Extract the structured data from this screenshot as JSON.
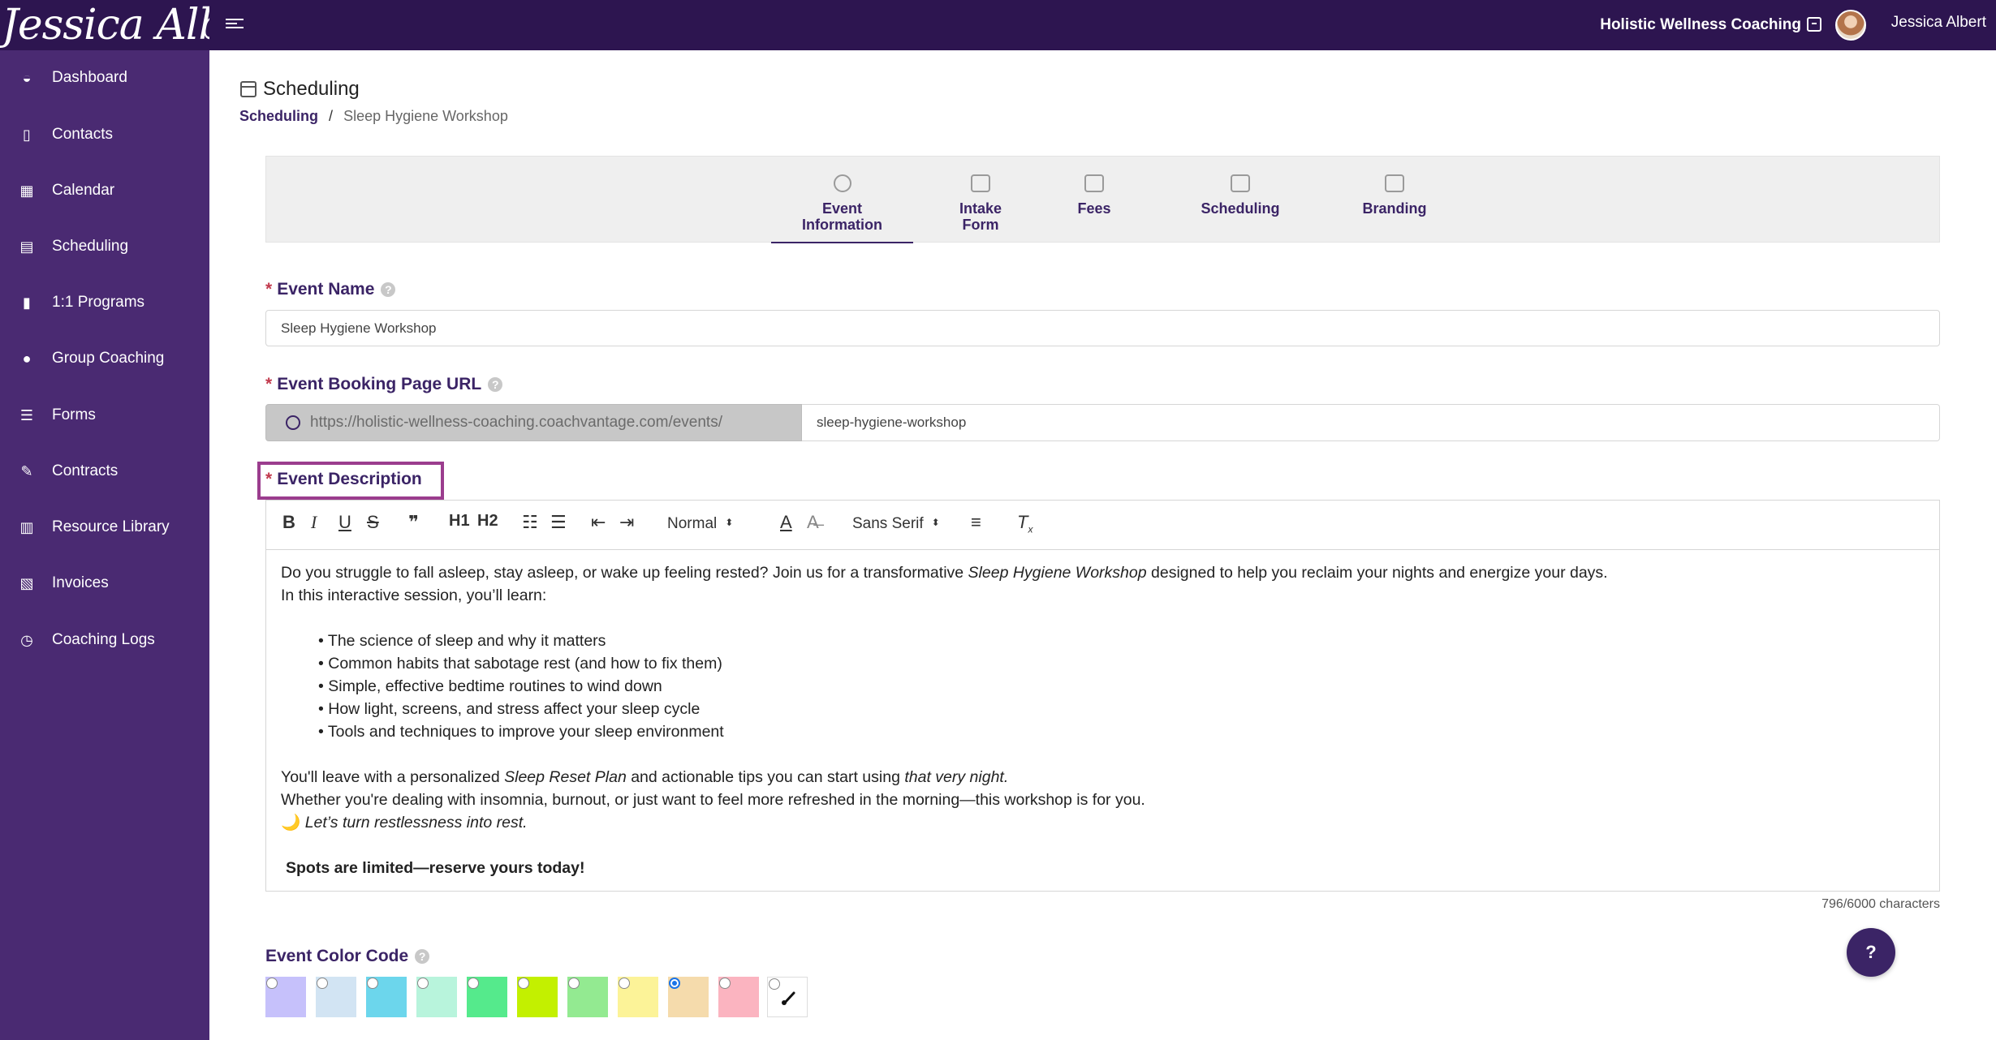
{
  "header": {
    "logo_text": "Jessica Albert",
    "org_name": "Holistic Wellness Coaching",
    "user_name": "Jessica Albert"
  },
  "sidebar": {
    "items": [
      {
        "label": "Dashboard",
        "icon": "dashboard-icon"
      },
      {
        "label": "Contacts",
        "icon": "contacts-icon"
      },
      {
        "label": "Calendar",
        "icon": "calendar-icon"
      },
      {
        "label": "Scheduling",
        "icon": "scheduling-icon"
      },
      {
        "label": "1:1 Programs",
        "icon": "book-icon"
      },
      {
        "label": "Group Coaching",
        "icon": "users-icon"
      },
      {
        "label": "Forms",
        "icon": "checklist-icon"
      },
      {
        "label": "Contracts",
        "icon": "signature-icon"
      },
      {
        "label": "Resource Library",
        "icon": "library-icon"
      },
      {
        "label": "Invoices",
        "icon": "invoice-icon"
      },
      {
        "label": "Coaching Logs",
        "icon": "clock-icon"
      }
    ]
  },
  "page": {
    "title": "Scheduling",
    "breadcrumb": {
      "root": "Scheduling",
      "separator": "/",
      "current": "Sleep Hygiene Workshop"
    }
  },
  "tabs": [
    {
      "line1": "Event",
      "line2": "Information",
      "active": true
    },
    {
      "line1": "Intake",
      "line2": "Form",
      "active": false
    },
    {
      "line1": "Fees",
      "line2": "",
      "active": false
    },
    {
      "line1": "Scheduling",
      "line2": "",
      "active": false
    },
    {
      "line1": "Branding",
      "line2": "",
      "active": false
    }
  ],
  "form": {
    "event_name_label": "Event Name",
    "event_name_value": "Sleep Hygiene Workshop",
    "booking_url_label": "Event Booking Page URL",
    "booking_url_prefix": "https://holistic-wellness-coaching.coachvantage.com/events/",
    "booking_url_slug": "sleep-hygiene-workshop",
    "description_label": "Event Description",
    "color_code_label": "Event Color Code",
    "required_mark": "*",
    "help_mark": "?"
  },
  "editor": {
    "toolbar": {
      "bold": "B",
      "italic": "I",
      "underline": "U",
      "strike": "S",
      "quote": "❞",
      "h1": "H1",
      "h2": "H2",
      "size_select": "Normal",
      "font_select": "Sans Serif"
    },
    "intro_before": "Do you struggle to fall asleep, stay asleep, or wake up feeling rested? Join us for a transformative ",
    "intro_italic": "Sleep Hygiene Workshop",
    "intro_after": " designed to help you reclaim your nights and energize your days.",
    "learn_line": "In this interactive session, you’ll learn:",
    "bullets": [
      "The science of sleep and why it matters",
      "Common habits that sabotage rest (and how to fix them)",
      "Simple, effective bedtime routines to wind down",
      "How light, screens, and stress affect your sleep cycle",
      "Tools and techniques to improve your sleep environment"
    ],
    "leave_before": "You'll leave with a personalized ",
    "leave_italic": "Sleep Reset Plan",
    "leave_middle": " and actionable tips you can start using ",
    "leave_italic2": "that very night.",
    "whether_line": "Whether you're dealing with insomnia, burnout, or just want to feel more refreshed in the morning—this workshop is for you.",
    "moon_emoji": "🌙",
    "moon_line": " Let’s turn restlessness into rest.",
    "closing_line": "Spots are limited—reserve yours today!",
    "char_count": "796/6000 characters"
  },
  "help_button_label": "?",
  "colors": {
    "header_bg": "#2d1550",
    "sidebar_bg": "#4a2a72",
    "accent": "#3b2466",
    "highlight": "#9b3d8e",
    "required": "#c23b4e"
  },
  "swatches": [
    {
      "color": "#c6c1fb",
      "selected": false
    },
    {
      "color": "#d2e4f3",
      "selected": false
    },
    {
      "color": "#6cd6ec",
      "selected": false
    },
    {
      "color": "#b8f4dc",
      "selected": false
    },
    {
      "color": "#55ea8c",
      "selected": false
    },
    {
      "color": "#c3f000",
      "selected": false
    },
    {
      "color": "#93ea91",
      "selected": false
    },
    {
      "color": "#fcf398",
      "selected": false
    },
    {
      "color": "#f5dbac",
      "selected": true
    },
    {
      "color": "#fbb4c0",
      "selected": false
    }
  ]
}
